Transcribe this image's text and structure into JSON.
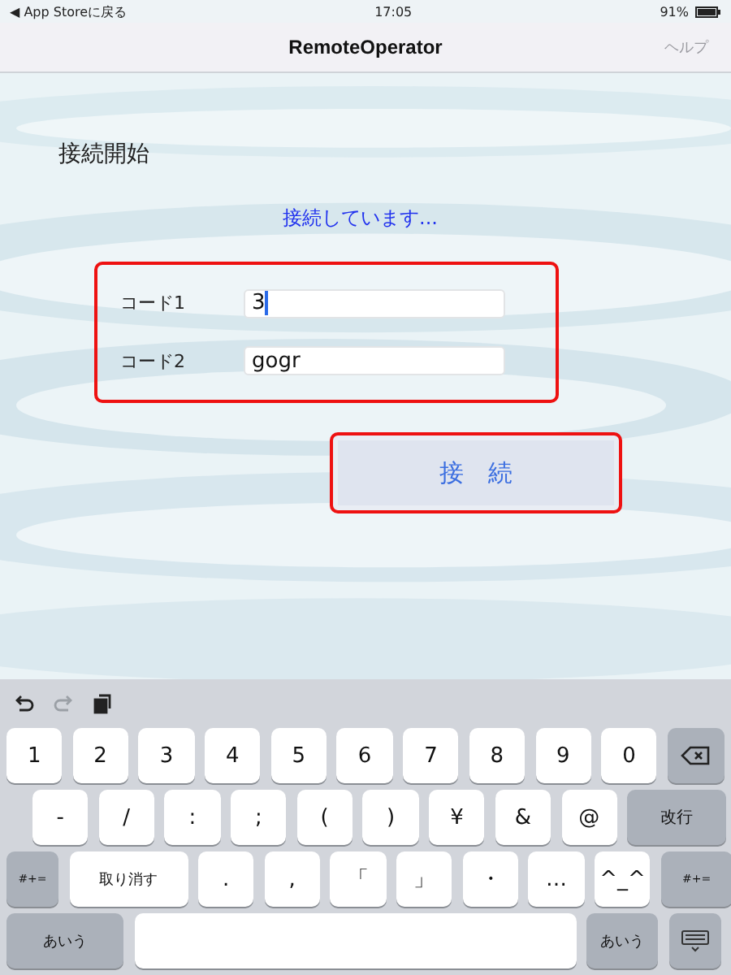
{
  "status_bar": {
    "back": "◀ App Storeに戻る",
    "time": "17:05",
    "battery": "91%"
  },
  "nav_bar": {
    "title": "RemoteOperator",
    "help": "ヘルプ",
    "help_disabled": true
  },
  "heading": "接続開始",
  "status_message": "接続しています...",
  "code_group": {
    "highlighted": true,
    "fields": [
      {
        "label": "コード1",
        "value": "3",
        "focused": true
      },
      {
        "label": "コード2",
        "value": "gogr",
        "focused": false
      }
    ]
  },
  "connect_button": {
    "label": "接　続",
    "highlighted": true
  },
  "keyboard": {
    "toolbar": [
      {
        "kind": "undo",
        "disabled": false
      },
      {
        "kind": "redo",
        "disabled": true
      },
      {
        "kind": "paste",
        "disabled": false
      }
    ],
    "rows": [
      [
        {
          "kind": "char",
          "label": "1"
        },
        {
          "kind": "char",
          "label": "2"
        },
        {
          "kind": "char",
          "label": "3"
        },
        {
          "kind": "char",
          "label": "4"
        },
        {
          "kind": "char",
          "label": "5"
        },
        {
          "kind": "char",
          "label": "6"
        },
        {
          "kind": "char",
          "label": "7"
        },
        {
          "kind": "char",
          "label": "8"
        },
        {
          "kind": "char",
          "label": "9"
        },
        {
          "kind": "char",
          "label": "0"
        },
        {
          "kind": "backspace"
        }
      ],
      [
        {
          "kind": "char",
          "label": "-"
        },
        {
          "kind": "char",
          "label": "/"
        },
        {
          "kind": "char",
          "label": ":"
        },
        {
          "kind": "char",
          "label": ";"
        },
        {
          "kind": "char",
          "label": "("
        },
        {
          "kind": "char",
          "label": ")"
        },
        {
          "kind": "char",
          "label": "¥"
        },
        {
          "kind": "char",
          "label": "&"
        },
        {
          "kind": "char",
          "label": "@"
        },
        {
          "kind": "return",
          "label": "改行"
        }
      ],
      [
        {
          "kind": "shift",
          "label": "#+="
        },
        {
          "kind": "undo",
          "label": "取り消す"
        },
        {
          "kind": "char",
          "label": "."
        },
        {
          "kind": "char",
          "label": ","
        },
        {
          "kind": "char",
          "label": "「"
        },
        {
          "kind": "char",
          "label": "」"
        },
        {
          "kind": "char",
          "label": "・"
        },
        {
          "kind": "char",
          "label": "…"
        },
        {
          "kind": "char",
          "label": "^_^"
        },
        {
          "kind": "shift",
          "label": "#+="
        }
      ],
      [
        {
          "kind": "mode",
          "label": "あいう"
        },
        {
          "kind": "space"
        },
        {
          "kind": "mode-small",
          "label": "あいう"
        },
        {
          "kind": "hide"
        }
      ]
    ]
  }
}
